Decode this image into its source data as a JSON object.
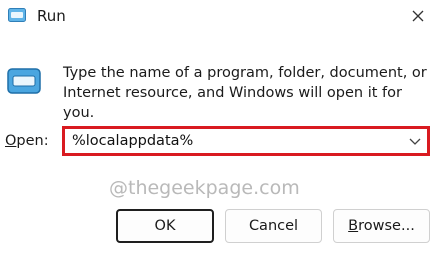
{
  "window": {
    "title": "Run",
    "close_icon": "close-icon",
    "app_icon": "run-app-icon"
  },
  "dialog": {
    "description": "Type the name of a program, folder, document, or Internet resource, and Windows will open it for you.",
    "open_label_accel": "O",
    "open_label_rest": "pen:",
    "open_value": "%localappdata%",
    "dropdown_icon": "chevron-down-icon",
    "watermark": "@thegeekpage.com",
    "highlight_color": "#d91a20"
  },
  "buttons": {
    "ok": "OK",
    "cancel": "Cancel",
    "browse_accel": "B",
    "browse_rest": "rowse..."
  }
}
